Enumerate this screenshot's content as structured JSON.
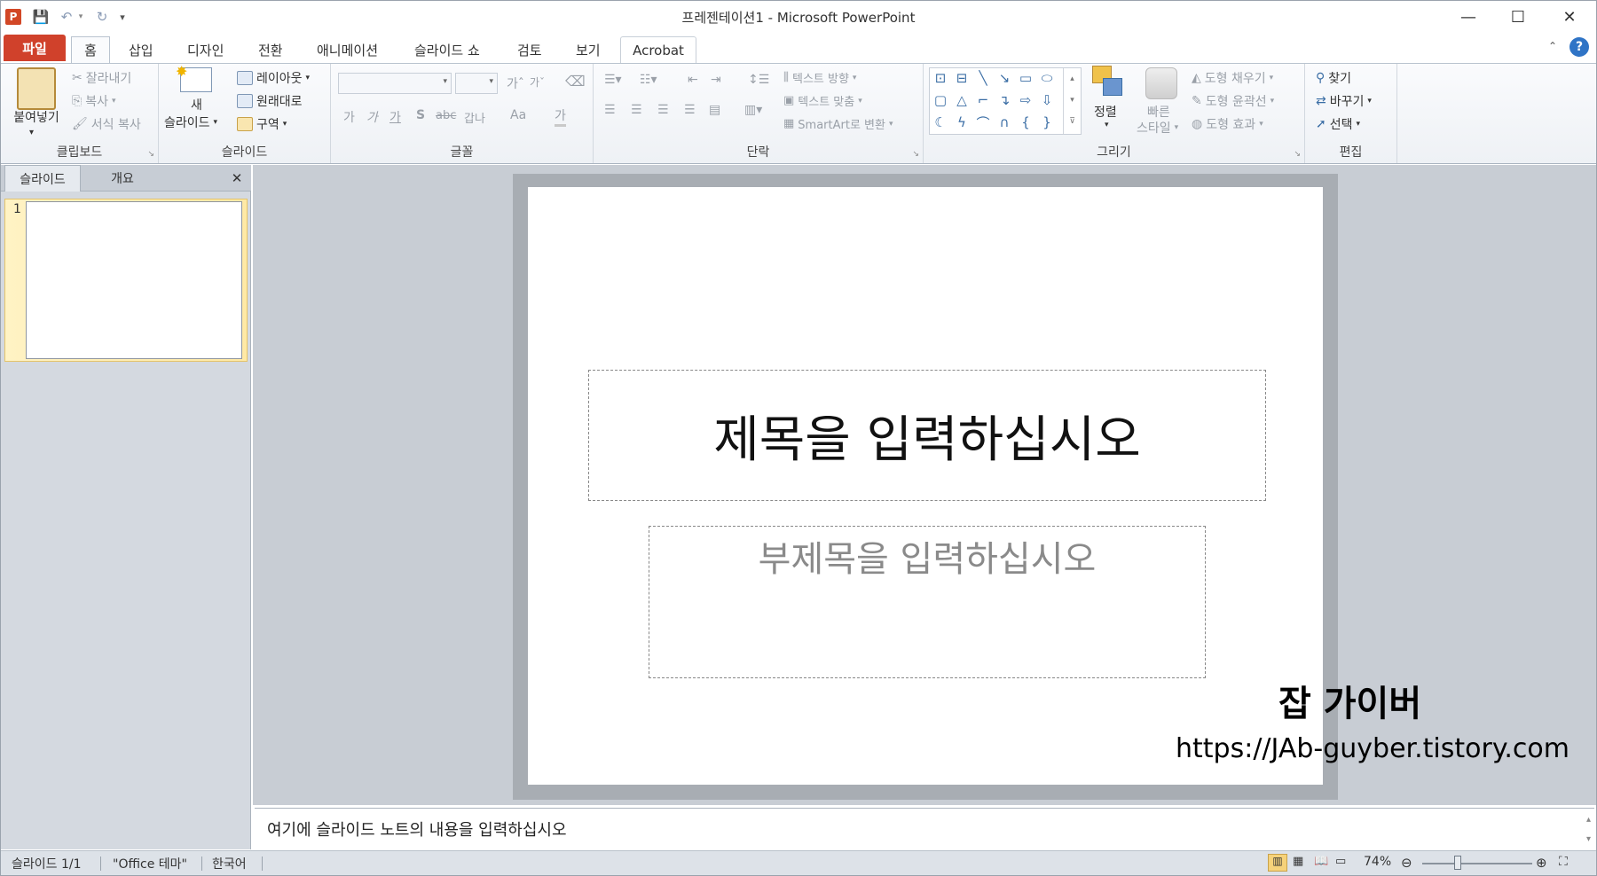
{
  "window": {
    "title": "프레젠테이션1 - Microsoft PowerPoint",
    "app_icon_letter": "P",
    "controls": {
      "minimize": "—",
      "maximize": "☐",
      "close": "✕"
    }
  },
  "ribbon_tabs": [
    "파일",
    "홈",
    "삽입",
    "디자인",
    "전환",
    "애니메이션",
    "슬라이드 쇼",
    "검토",
    "보기",
    "Acrobat"
  ],
  "groups": {
    "clipboard": {
      "label": "클립보드",
      "paste": "붙여넣기",
      "cut": "잘라내기",
      "copy": "복사",
      "format_painter": "서식 복사"
    },
    "slides": {
      "label": "슬라이드",
      "new_slide_1": "새",
      "new_slide_2": "슬라이드",
      "layout": "레이아웃",
      "reset": "원래대로",
      "section": "구역"
    },
    "font": {
      "label": "글꼴",
      "bold": "가",
      "italic": "가",
      "underline": "가",
      "shadow": "S",
      "strike": "abc",
      "spacing": "갑나",
      "case": "Aa",
      "color": "가"
    },
    "paragraph": {
      "label": "단락",
      "text_direction": "텍스트 방향",
      "align_text": "텍스트 맞춤",
      "smartart": "SmartArt로 변환"
    },
    "drawing": {
      "label": "그리기",
      "arrange": "정렬",
      "quick_styles_1": "빠른",
      "quick_styles_2": "스타일",
      "fill": "도형 채우기",
      "outline": "도형 윤곽선",
      "effects": "도형 효과"
    },
    "editing": {
      "label": "편집",
      "find": "찾기",
      "replace": "바꾸기",
      "select": "선택"
    }
  },
  "left_pane": {
    "tab_slides": "슬라이드",
    "tab_outline": "개요",
    "close": "✕",
    "slide_number": "1"
  },
  "slide": {
    "title_placeholder": "제목을 입력하십시오",
    "subtitle_placeholder": "부제목을 입력하십시오"
  },
  "watermark": {
    "name": "잡 가이버",
    "url": "https://JAb-guyber.tistory.com"
  },
  "notes": {
    "placeholder": "여기에 슬라이드 노트의 내용을 입력하십시오"
  },
  "status": {
    "slide": "슬라이드 1/1",
    "theme": "\"Office 테마\"",
    "language": "한국어",
    "zoom": "74%"
  }
}
